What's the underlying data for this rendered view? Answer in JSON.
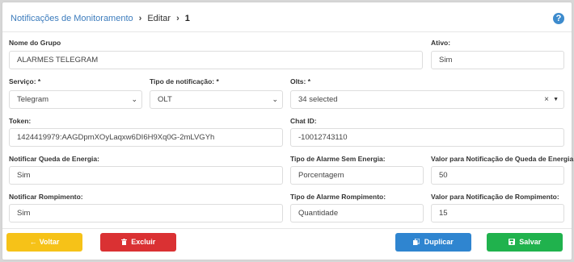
{
  "breadcrumb": {
    "root": "Notificações de Monitoramento",
    "edit": "Editar",
    "id": "1",
    "separator": "›"
  },
  "help_label": "?",
  "form": {
    "group_name": {
      "label": "Nome do Grupo",
      "value": "ALARMES TELEGRAM"
    },
    "active": {
      "label": "Ativo:",
      "value": "Sim"
    },
    "service": {
      "label": "Serviço: *",
      "value": "Telegram"
    },
    "notification_type": {
      "label": "Tipo de notificação: *",
      "value": "OLT"
    },
    "olts": {
      "label": "Olts: *",
      "value": "34 selected"
    },
    "token": {
      "label": "Token:",
      "value": "1424419979:AAGDpmXOyLaqxw6DI6H9Xq0G-2mLVGYh"
    },
    "chat_id": {
      "label": "Chat ID:",
      "value": "-10012743110"
    },
    "notify_power_loss": {
      "label": "Notificar Queda de Energia:",
      "value": "Sim"
    },
    "alarm_type_power": {
      "label": "Tipo de Alarme Sem Energia:",
      "value": "Porcentagem"
    },
    "power_loss_value": {
      "label": "Valor para Notificação de Queda de Energia:",
      "value": "50"
    },
    "notify_break": {
      "label": "Notificar Rompimento:",
      "value": "Sim"
    },
    "alarm_type_break": {
      "label": "Tipo de Alarme Rompimento:",
      "value": "Quantidade"
    },
    "break_value": {
      "label": "Valor para Notificação de Rompimento:",
      "value": "15"
    }
  },
  "buttons": {
    "back": "Voltar",
    "delete": "Excluir",
    "duplicate": "Duplicar",
    "save": "Salvar"
  },
  "icons": {
    "back": "arrow-left-icon",
    "delete": "trash-icon",
    "duplicate": "copy-icon",
    "save": "floppy-disk-icon",
    "help": "question-circle-icon",
    "dropdown": "chevron-down-icon",
    "clear": "close-icon"
  },
  "colors": {
    "back": "#f6c218",
    "delete": "#da3133",
    "duplicate": "#2f85d0",
    "save": "#20b24d",
    "link": "#3c7cbd",
    "help": "#3d8bcd"
  }
}
